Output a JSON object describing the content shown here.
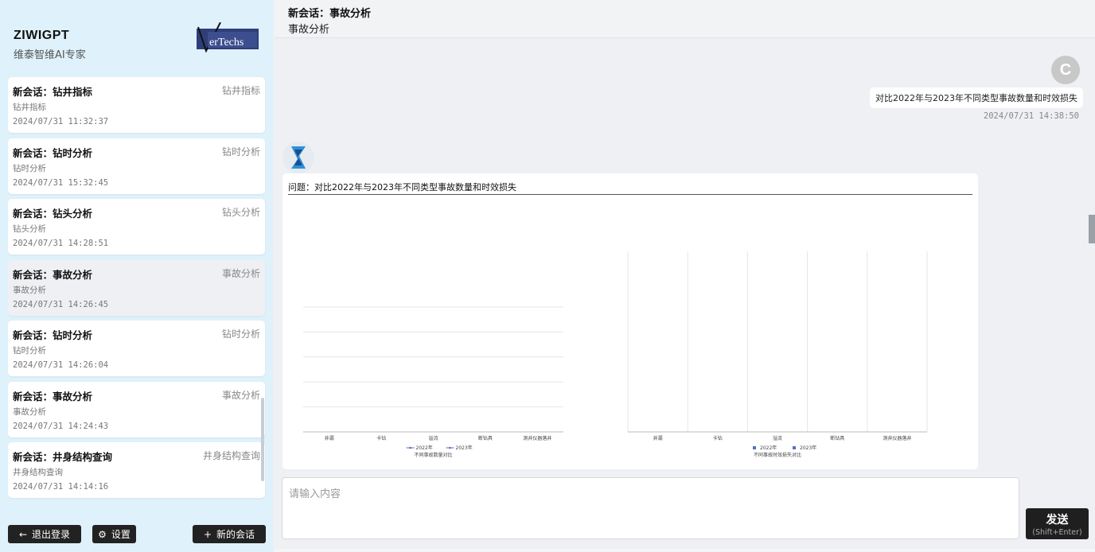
{
  "brand": {
    "name": "ZIWIGPT",
    "subtitle": "维泰智维AI专家",
    "logo_text": "erTechs"
  },
  "sessions": [
    {
      "title": "新会话：钻井指标",
      "tag": "钻井指标",
      "preview": "钻井指标",
      "time": "2024/07/31  11:32:37"
    },
    {
      "title": "新会话：钻时分析",
      "tag": "钻时分析",
      "preview": "钻时分析",
      "time": "2024/07/31  15:32:45"
    },
    {
      "title": "新会话：钻头分析",
      "tag": "钻头分析",
      "preview": "钻头分析",
      "time": "2024/07/31  14:28:51"
    },
    {
      "title": "新会话：事故分析",
      "tag": "事故分析",
      "preview": "事故分析",
      "time": "2024/07/31  14:26:45"
    },
    {
      "title": "新会话：钻时分析",
      "tag": "钻时分析",
      "preview": "钻时分析",
      "time": "2024/07/31  14:26:04"
    },
    {
      "title": "新会话：事故分析",
      "tag": "事故分析",
      "preview": "事故分析",
      "time": "2024/07/31  14:24:43"
    },
    {
      "title": "新会话：井身结构查询",
      "tag": "井身结构查询",
      "preview": "井身结构查询",
      "time": "2024/07/31  14:14:16"
    }
  ],
  "sidebar_buttons": {
    "logout": "退出登录",
    "settings": "设置",
    "new_chat": "新的会话"
  },
  "header": {
    "title": "新会话：事故分析",
    "subtitle": "事故分析"
  },
  "chat": {
    "user_avatar": "C",
    "user_message": "对比2022年与2023年不同类型事故数量和时效损失",
    "user_time": "2024/07/31  14:38:50",
    "bot_question": "问题：对比2022年与2023年不同类型事故数量和时效损失"
  },
  "chart_data": [
    {
      "type": "line",
      "title": "不同事故数量对比",
      "categories": [
        "井漏",
        "卡钻",
        "溢流",
        "断钻具",
        "测井仪器落井"
      ],
      "series": [
        {
          "name": "2022年",
          "color": "#5470c6",
          "values": []
        },
        {
          "name": "2023年",
          "color": "#5470c6",
          "values": []
        }
      ],
      "grid": true,
      "legend": "bottom"
    },
    {
      "type": "bar",
      "title": "不同事故时效损失对比",
      "categories": [
        "井漏",
        "卡钻",
        "溢流",
        "断钻具",
        "测井仪器落井"
      ],
      "series": [
        {
          "name": "2022年",
          "color": "#5470c6",
          "values": []
        },
        {
          "name": "2023年",
          "color": "#5470c6",
          "values": []
        }
      ],
      "grid": true,
      "legend": "bottom"
    }
  ],
  "input": {
    "placeholder": "请输入内容",
    "value": ""
  },
  "send": {
    "label": "发送",
    "hint": "(Shift+Enter)"
  },
  "colors": {
    "sidebar_bg": "#dff1fb",
    "main_bg": "#eef0f3",
    "button_dark": "#222222",
    "logo_bg": "#2f3e7a",
    "bot_logo": "#2f8fd6"
  }
}
